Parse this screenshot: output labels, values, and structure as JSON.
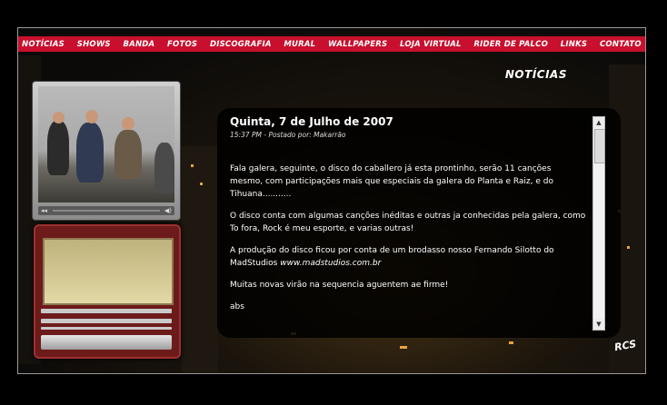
{
  "nav": {
    "items": [
      "NOTÍCIAS",
      "SHOWS",
      "BANDA",
      "FOTOS",
      "DISCOGRAFIA",
      "MURAL",
      "WALLPAPERS",
      "LOJA VIRTUAL",
      "RIDER DE PALCO",
      "LINKS",
      "CONTATO"
    ]
  },
  "section": {
    "title": "NOTÍCIAS"
  },
  "player": {
    "prev_icon": "◂◂",
    "volume_icon": "◀)"
  },
  "post": {
    "title": "Quinta, 7 de Julho de 2007",
    "meta": "15:37 PM - Postado por: Makarrão",
    "paragraphs": [
      "Fala galera, seguinte, o disco do caballero já esta prontinho, serão 11 canções mesmo, com participações mais que especiais da galera do Planta e Raiz, e do Tihuana...........",
      "O disco conta com algumas canções inéditas e outras ja conhecidas pela galera, como To fora, Rock é meu esporte, e varias outras!",
      "A produção do disco ficou por conta de um brodasso nosso Fernando Silotto do MadStudios",
      "Muitas novas virão na sequencia aguentem ae firme!",
      "abs"
    ],
    "link": "www.madstudios.com.br"
  },
  "scrollbar": {
    "up": "▲",
    "down": "▼"
  },
  "logo": {
    "text": "RCS"
  },
  "colors": {
    "nav_red": "#c8102e",
    "mini_player": "#6d1a1a"
  }
}
